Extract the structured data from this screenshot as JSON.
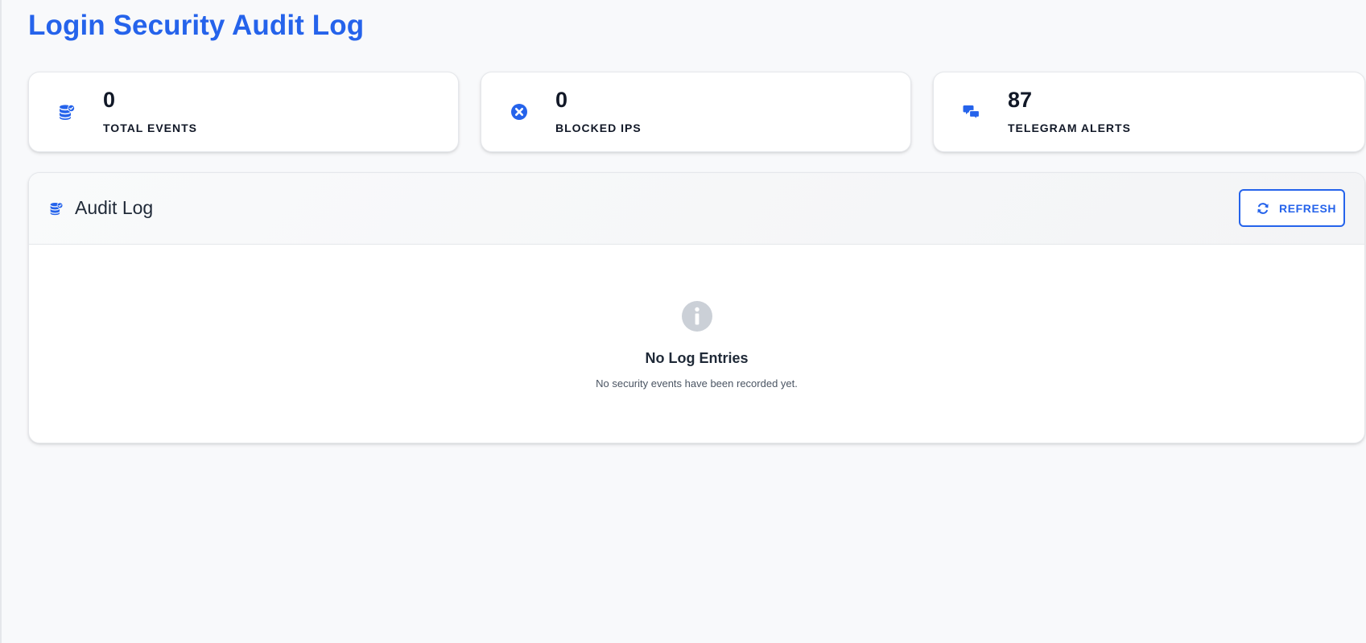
{
  "page": {
    "title": "Login Security Audit Log"
  },
  "stats": [
    {
      "icon": "database-check-icon",
      "value": "0",
      "label": "Total Events"
    },
    {
      "icon": "circle-x-icon",
      "value": "0",
      "label": "Blocked IPs"
    },
    {
      "icon": "chat-bubbles-icon",
      "value": "87",
      "label": "Telegram Alerts"
    }
  ],
  "audit_log": {
    "icon": "database-check-icon",
    "title": "Audit Log",
    "refresh_label": "Refresh",
    "refresh_icon": "refresh-icon",
    "empty_state": {
      "icon": "info-circle-icon",
      "title": "No Log Entries",
      "text": "No security events have been recorded yet."
    }
  },
  "colors": {
    "accent": "#2563eb",
    "page_background": "#f8f9fb",
    "card_background": "#ffffff",
    "muted_icon": "#cbd0d7"
  }
}
